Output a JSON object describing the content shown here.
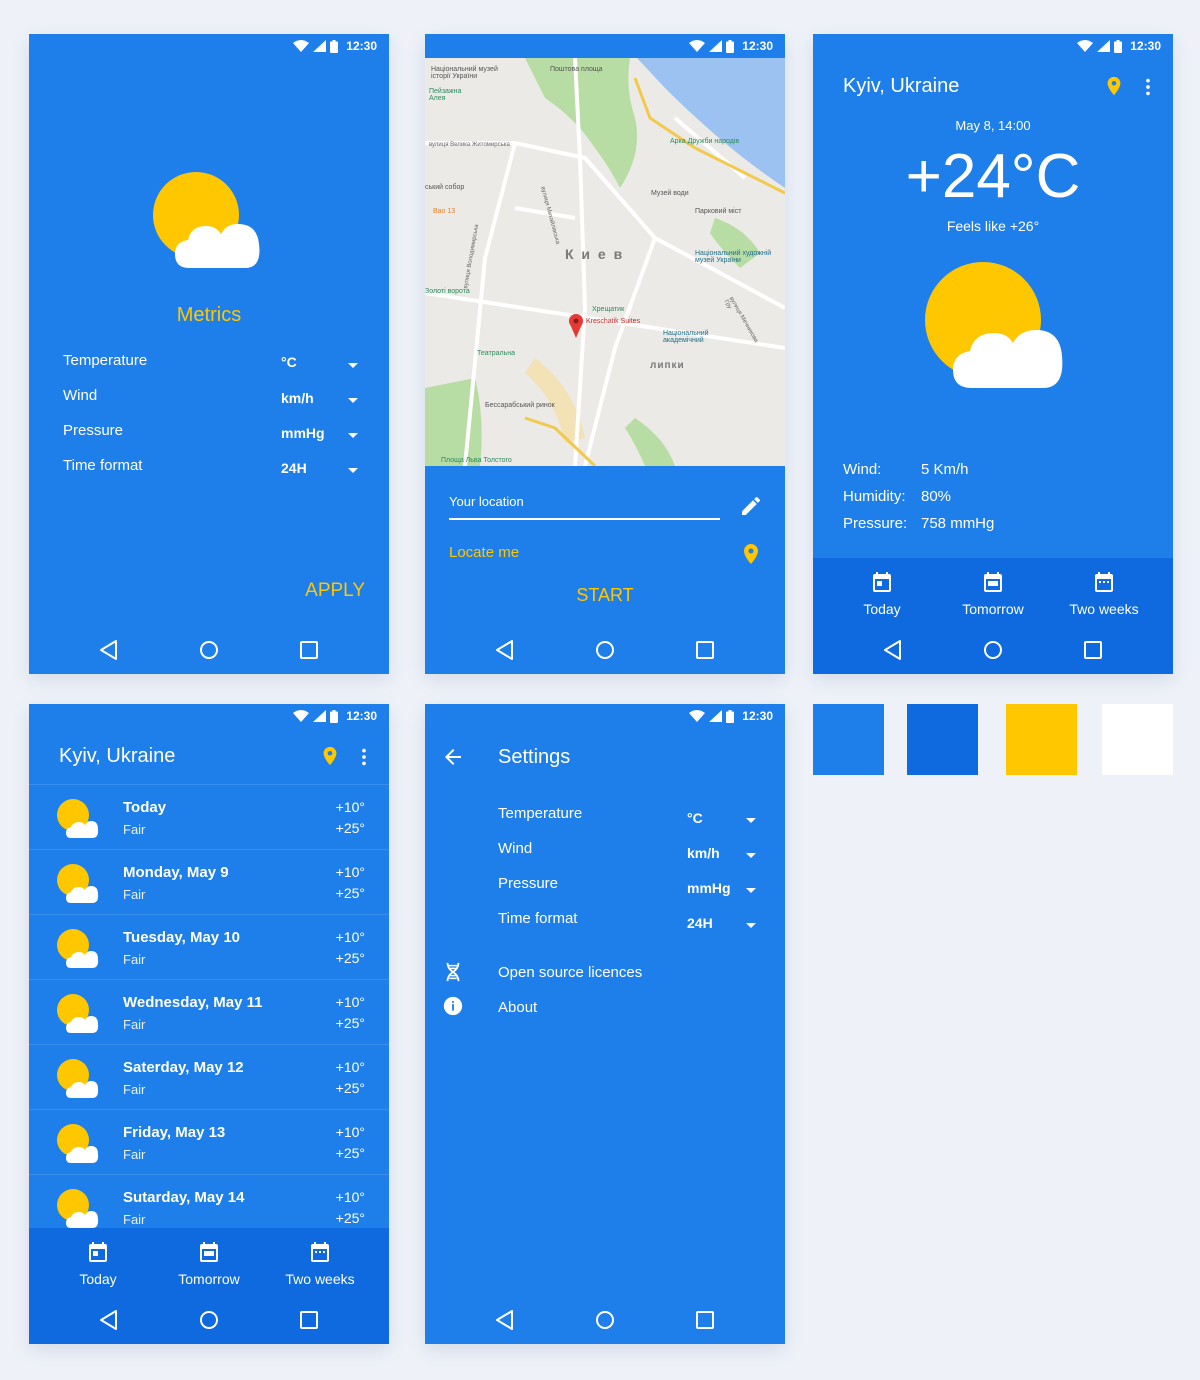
{
  "status": {
    "time": "12:30"
  },
  "metrics": {
    "title": "Metrics",
    "rows": [
      {
        "label": "Temperature",
        "value": "°C"
      },
      {
        "label": "Wind",
        "value": "km/h"
      },
      {
        "label": "Pressure",
        "value": "mmHg"
      },
      {
        "label": "Time format",
        "value": "24H"
      }
    ],
    "apply_label": "APPLY"
  },
  "map_screen": {
    "labels": {
      "kiev": "К и е в",
      "lipki": "липки",
      "poshtova": "Поштова площа",
      "arka": "Арка Дружби народів",
      "muzei_vody": "Музей води",
      "parkovyi": "Парковий міст",
      "khreshchatyk": "Хрещатик",
      "kreschatik_suites": "Kreschatik Suites",
      "natsionalnyi": "Національний художній музей України",
      "akademichnyi": "Національний академічний",
      "teatralna": "Театральна",
      "bessarabskyi": "Бессарабський ринок",
      "zoloti": "Золоті ворота",
      "lva_tolstoho": "Площа Льва Толстого",
      "istorii": "Національний музей історії України",
      "desiatynna": "Пейзажна Алея",
      "zhytomyrska": "вулиця Велика Житомирська",
      "sobor": "ський собор",
      "bao": "Bao 13",
      "mykhailivska": "вулиця Михайлівська",
      "volodymyrska": "вулиця Володимирська",
      "mechnykova": "вулиця Мечникова Гру"
    },
    "location_label": "Your location",
    "locate_label": "Locate me",
    "start_label": "START"
  },
  "today": {
    "city": "Kyiv, Ukraine",
    "datetime": "May 8, 14:00",
    "temperature": "+24°C",
    "feels_like": "Feels like +26°",
    "details": [
      {
        "label": "Wind:",
        "value": "5 Km/h"
      },
      {
        "label": "Humidity:",
        "value": "80%"
      },
      {
        "label": "Pressure:",
        "value": "758 mmHg"
      }
    ]
  },
  "tabs": [
    "Today",
    "Tomorrow",
    "Two weeks"
  ],
  "forecast": {
    "city": "Kyiv, Ukraine",
    "days": [
      {
        "title": "Today",
        "sub": "Fair",
        "min": "+10°",
        "max": "+25°"
      },
      {
        "title": "Monday, May 9",
        "sub": "Fair",
        "min": "+10°",
        "max": "+25°"
      },
      {
        "title": "Tuesday, May 10",
        "sub": "Fair",
        "min": "+10°",
        "max": "+25°"
      },
      {
        "title": "Wednesday, May 11",
        "sub": "Fair",
        "min": "+10°",
        "max": "+25°"
      },
      {
        "title": "Saterday, May 12",
        "sub": "Fair",
        "min": "+10°",
        "max": "+25°"
      },
      {
        "title": "Friday, May 13",
        "sub": "Fair",
        "min": "+10°",
        "max": "+25°"
      },
      {
        "title": "Sutarday, May 14",
        "sub": "Fair",
        "min": "+10°",
        "max": "+25°"
      }
    ]
  },
  "settings": {
    "title": "Settings",
    "rows": [
      {
        "label": "Temperature",
        "value": "°C"
      },
      {
        "label": "Wind",
        "value": "km/h"
      },
      {
        "label": "Pressure",
        "value": "mmHg"
      },
      {
        "label": "Time format",
        "value": "24H"
      }
    ],
    "licences_label": "Open source licences",
    "about_label": "About"
  },
  "palette": [
    "#1e7fea",
    "#0f6ae0",
    "#ffc700",
    "#ffffff"
  ]
}
